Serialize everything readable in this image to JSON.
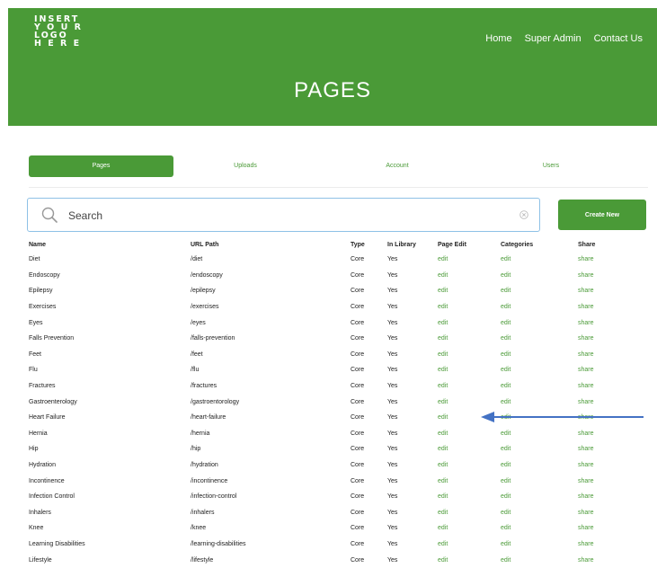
{
  "logo": {
    "lines": [
      "INSERT",
      "Y O U R",
      "LOGO",
      "H E R E"
    ]
  },
  "nav": {
    "home": "Home",
    "super_admin": "Super Admin",
    "contact_us": "Contact Us"
  },
  "page_title": "PAGES",
  "tabs": [
    "Pages",
    "Uploads",
    "Account",
    "Users"
  ],
  "active_tab": "Pages",
  "search": {
    "placeholder": "Search",
    "value": ""
  },
  "create_button": "Create New",
  "table": {
    "columns": [
      "Name",
      "URL Path",
      "Type",
      "In Library",
      "Page Edit",
      "Categories",
      "Share"
    ],
    "rows": [
      {
        "name": "Diet",
        "path": "/diet",
        "type": "Core",
        "library": "Yes",
        "edit": "edit",
        "categories": "edit",
        "share": "share"
      },
      {
        "name": "Endoscopy",
        "path": "/endoscopy",
        "type": "Core",
        "library": "Yes",
        "edit": "edit",
        "categories": "edit",
        "share": "share"
      },
      {
        "name": "Epilepsy",
        "path": "/epilepsy",
        "type": "Core",
        "library": "Yes",
        "edit": "edit",
        "categories": "edit",
        "share": "share"
      },
      {
        "name": "Exercises",
        "path": "/exercises",
        "type": "Core",
        "library": "Yes",
        "edit": "edit",
        "categories": "edit",
        "share": "share"
      },
      {
        "name": "Eyes",
        "path": "/eyes",
        "type": "Core",
        "library": "Yes",
        "edit": "edit",
        "categories": "edit",
        "share": "share"
      },
      {
        "name": "Falls Prevention",
        "path": "/falls-prevention",
        "type": "Core",
        "library": "Yes",
        "edit": "edit",
        "categories": "edit",
        "share": "share"
      },
      {
        "name": "Feet",
        "path": "/feet",
        "type": "Core",
        "library": "Yes",
        "edit": "edit",
        "categories": "edit",
        "share": "share"
      },
      {
        "name": "Flu",
        "path": "/flu",
        "type": "Core",
        "library": "Yes",
        "edit": "edit",
        "categories": "edit",
        "share": "share"
      },
      {
        "name": "Fractures",
        "path": "/fractures",
        "type": "Core",
        "library": "Yes",
        "edit": "edit",
        "categories": "edit",
        "share": "share"
      },
      {
        "name": "Gastroenterology",
        "path": "/gastroentorology",
        "type": "Core",
        "library": "Yes",
        "edit": "edit",
        "categories": "edit",
        "share": "share"
      },
      {
        "name": "Heart Failure",
        "path": "/heart-failure",
        "type": "Core",
        "library": "Yes",
        "edit": "edit",
        "categories": "edit",
        "share": "share"
      },
      {
        "name": "Hernia",
        "path": "/hernia",
        "type": "Core",
        "library": "Yes",
        "edit": "edit",
        "categories": "edit",
        "share": "share"
      },
      {
        "name": "Hip",
        "path": "/hip",
        "type": "Core",
        "library": "Yes",
        "edit": "edit",
        "categories": "edit",
        "share": "share"
      },
      {
        "name": "Hydration",
        "path": "/hydration",
        "type": "Core",
        "library": "Yes",
        "edit": "edit",
        "categories": "edit",
        "share": "share"
      },
      {
        "name": "Incontinence",
        "path": "/incontinence",
        "type": "Core",
        "library": "Yes",
        "edit": "edit",
        "categories": "edit",
        "share": "share"
      },
      {
        "name": "Infection Control",
        "path": "/infection-control",
        "type": "Core",
        "library": "Yes",
        "edit": "edit",
        "categories": "edit",
        "share": "share"
      },
      {
        "name": "Inhalers",
        "path": "/inhalers",
        "type": "Core",
        "library": "Yes",
        "edit": "edit",
        "categories": "edit",
        "share": "share"
      },
      {
        "name": "Knee",
        "path": "/knee",
        "type": "Core",
        "library": "Yes",
        "edit": "edit",
        "categories": "edit",
        "share": "share"
      },
      {
        "name": "Learning Disabilities",
        "path": "/learning-disabilities",
        "type": "Core",
        "library": "Yes",
        "edit": "edit",
        "categories": "edit",
        "share": "share"
      },
      {
        "name": "Lifestyle",
        "path": "/lifestyle",
        "type": "Core",
        "library": "Yes",
        "edit": "edit",
        "categories": "edit",
        "share": "share"
      }
    ]
  },
  "colors": {
    "brand_green": "#4a9a37",
    "annotation_arrow": "#4472c4",
    "search_focus": "#8ec1e6"
  }
}
